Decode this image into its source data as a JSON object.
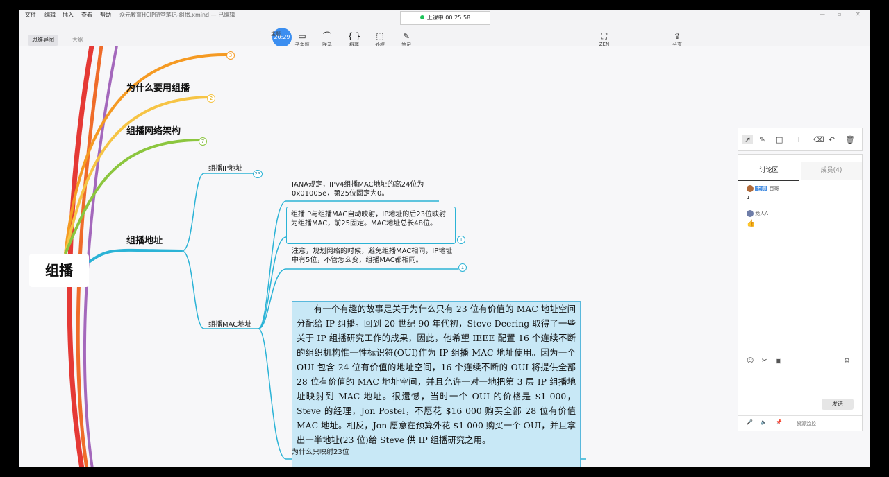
{
  "window": {
    "title": "众元教育HCIP随堂笔记-组播.xmind — 已编辑"
  },
  "menu": [
    "文件",
    "编辑",
    "插入",
    "查看",
    "帮助"
  ],
  "view_tabs": {
    "active": "思维导图",
    "other": "大纲"
  },
  "toolbar": {
    "items": [
      {
        "label": "主题",
        "icon": "topic-icon"
      },
      {
        "label": "子主题",
        "icon": "subtopic-icon"
      },
      {
        "label": "联系",
        "icon": "relation-icon"
      },
      {
        "label": "概要",
        "icon": "summary-icon"
      },
      {
        "label": "外框",
        "icon": "boundary-icon"
      },
      {
        "label": "笔记",
        "icon": "note-icon"
      },
      {
        "label": "ZEN",
        "icon": "zen-icon"
      },
      {
        "label": "分享",
        "icon": "share-icon"
      }
    ],
    "clock_overlay": "20:29"
  },
  "timer": {
    "text": "上课中 00:25:58"
  },
  "mindmap": {
    "root": "组播",
    "topics": [
      {
        "label": "为什么要用组播",
        "badge": "2"
      },
      {
        "label": "组播网络架构",
        "badge": "7"
      },
      {
        "label": "组播地址"
      }
    ],
    "top_badge": "3",
    "subtopics": [
      {
        "label": "组播IP地址",
        "badge": "23"
      },
      {
        "label": "组播MAC地址"
      }
    ],
    "notes": [
      {
        "text": "IANA规定，IPv4组播MAC地址的高24位为0x01005e，第25位固定为0。"
      },
      {
        "text": "组播IP与组播MAC自动映射，IP地址的后23位映射为组播MAC，前25固定。MAC地址总长48位。",
        "badge": "1"
      },
      {
        "text": "注意，规划网络的时候，避免组播MAC相同，IP地址中有5位，不管怎么变，组播MAC都相同。",
        "badge": "1"
      },
      {
        "text": "为什么只映射23位"
      }
    ],
    "book_excerpt": "有一个有趣的故事是关于为什么只有 23 位有价值的 MAC 地址空间分配给 IP 组播。回到 20 世纪 90 年代初，Steve Deering 取得了一些关于 IP 组播研究工作的成果，因此，他希望 IEEE 配置 16 个连续不断的组织机构惟一性标识符(OUI)作为 IP 组播 MAC 地址使用。因为一个 OUI 包含 24 位有价值的地址空间，16 个连续不断的 OUI 将提供全部 28 位有价值的 MAC 地址空间，并且允许一对一地把第 3 层 IP 组播地址映射到 MAC 地址。很遗憾，当时一个 OUI 的价格是 $1 000，Steve 的经理，Jon Postel，不愿花 $16 000 购买全部 28 位有价值 MAC 地址。相反，Jon 愿意在预算外花 $1 000 购买一个 OUI，并且拿出一半地址(23 位)给 Steve 供 IP 组播研究之用。"
  },
  "discussion": {
    "tab_active": "讨论区",
    "tab_members": "成员(4)",
    "messages": [
      {
        "role": "老师",
        "name": "百哥",
        "text": "1"
      },
      {
        "name": "龙人A",
        "text": "👍"
      }
    ],
    "send": "发送",
    "resource_monitor": "资源监控"
  },
  "colors": {
    "accent_blue": "#2bb3d6",
    "branch_orange": "#f59a23",
    "branch_yellow": "#f6c445",
    "branch_green": "#8cc63f",
    "book_bg": "#c8e8f6"
  }
}
